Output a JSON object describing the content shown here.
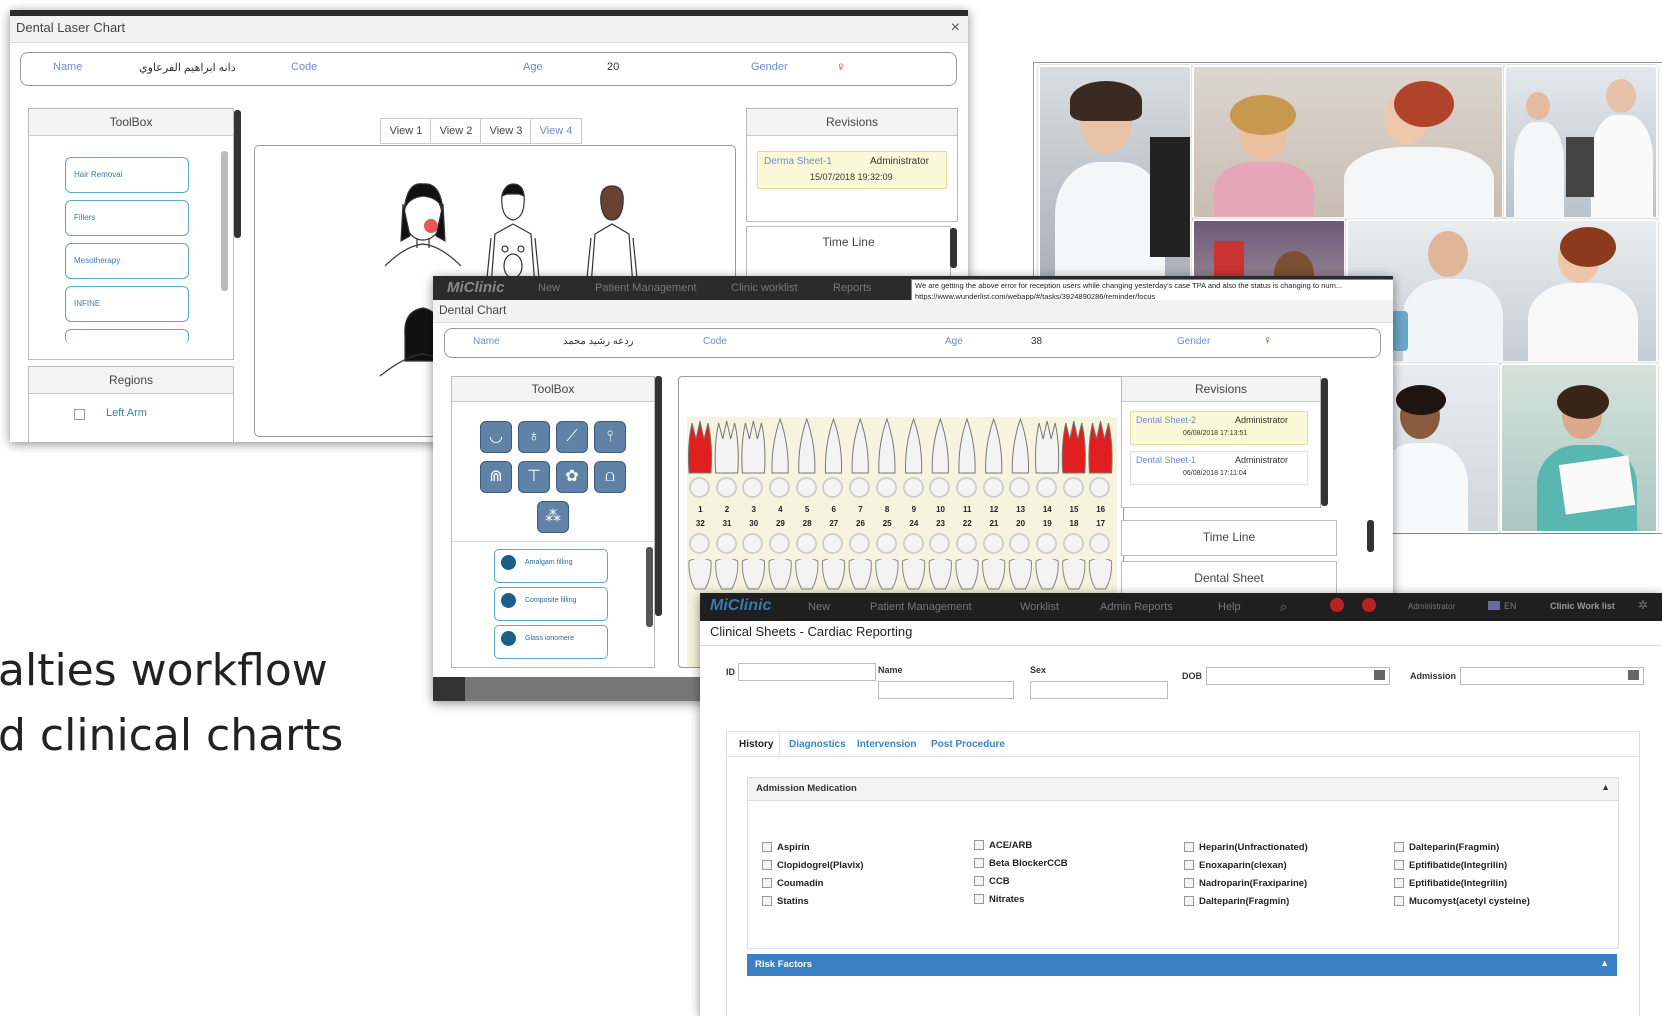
{
  "caption": {
    "line1": "alties workflow",
    "line2": "d clinical charts"
  },
  "laser_chart": {
    "title": "Dental Laser Chart",
    "close": "×",
    "patient": {
      "name_label": "Name",
      "name_value": "دانه ابراهيم الفرعاوي",
      "code_label": "Code",
      "age_label": "Age",
      "age_value": "20",
      "gender_label": "Gender",
      "gender_icon": "♀"
    },
    "toolbox": {
      "title": "ToolBox",
      "items": [
        "Hair Removal",
        "Fillers",
        "Mesotherapy",
        "INFINE"
      ]
    },
    "regions": {
      "title": "Regions",
      "items": [
        "Left Arm"
      ]
    },
    "views": [
      "View 1",
      "View 2",
      "View 3",
      "View 4"
    ],
    "revisions": {
      "title": "Revisions",
      "items": [
        {
          "name": "Derma Sheet-1",
          "user": "Administrator",
          "date": "15/07/2018 19:32:09"
        }
      ]
    },
    "timeline": {
      "title": "Time Line"
    }
  },
  "dental_chart": {
    "nav": {
      "logo": "MiClinic",
      "items": [
        "New",
        "Patient Management",
        "Clinic worklist",
        "Reports"
      ]
    },
    "tooltip": {
      "line1": "We are getting the above error for reception users while changing yesterday's case TPA and also the status is changing to num...",
      "line2": "https://www.wunderlist.com/webapp/#/tasks/3924890286/reminder/focus"
    },
    "title": "Dental Chart",
    "patient": {
      "name_label": "Name",
      "name_value": "ردعه رشيد محمد",
      "code_label": "Code",
      "age_label": "Age",
      "age_value": "38",
      "gender_label": "Gender",
      "gender_icon": "♀"
    },
    "toolbox": {
      "title": "ToolBox",
      "fillings": [
        "Amalgam filling",
        "Composite filling",
        "Glass ionomere"
      ]
    },
    "upper_numbers": [
      "1",
      "2",
      "3",
      "4",
      "5",
      "6",
      "7",
      "8",
      "9",
      "10",
      "11",
      "12",
      "13",
      "14",
      "15",
      "16"
    ],
    "lower_numbers": [
      "32",
      "31",
      "30",
      "29",
      "28",
      "27",
      "26",
      "25",
      "24",
      "23",
      "22",
      "21",
      "20",
      "19",
      "18",
      "17"
    ],
    "revisions": {
      "title": "Revisions",
      "items": [
        {
          "name": "Dental Sheet-2",
          "user": "Administrator",
          "date": "06/08/2018 17:13:51"
        },
        {
          "name": "Dental Sheet-1",
          "user": "Administrator",
          "date": "06/08/2018 17:11:04"
        }
      ]
    },
    "timeline": {
      "title": "Time Line"
    },
    "dental_sheet": {
      "title": "Dental Sheet"
    },
    "colors": {
      "decay": "#e02020",
      "tooth": "#f3f3f3"
    }
  },
  "cardiac": {
    "nav": {
      "logo": "MiClinic",
      "items": [
        "New",
        "Patient Management",
        "Worklist",
        "Admin Reports",
        "Help"
      ],
      "user": "Administrator",
      "lang": "EN",
      "worklist": "Clinic Work list"
    },
    "title": "Clinical Sheets - Cardiac Reporting",
    "fields": {
      "id": "ID",
      "name": "Name",
      "sex": "Sex",
      "dob": "DOB",
      "admission": "Admission"
    },
    "tabs": [
      "History",
      "Diagnostics",
      "Intervension",
      "Post Procedure"
    ],
    "section1": {
      "title": "Admission Medication",
      "toggle": "▲"
    },
    "medications": [
      [
        "Aspirin",
        "Clopidogrel(Plavix)",
        "Coumadin",
        "Statins"
      ],
      [
        "ACE/ARB",
        "Beta BlockerCCB",
        "CCB",
        "Nitrates"
      ],
      [
        "Heparin(Unfractionated)",
        "Enoxaparin(clexan)",
        "Nadroparin(Fraxiparine)",
        "Dalteparin(Fragmin)"
      ],
      [
        "Dalteparin(Fragmin)",
        "Eptifibatide(Integrilin)",
        "Eptifibatide(Integrilin)",
        "Mucomyst(acetyl cysteine)"
      ]
    ],
    "section2": {
      "title": "Risk Factors",
      "toggle": "▲"
    },
    "colors": {
      "accent": "#3a87c4",
      "section_bar": "#3b7fc4"
    }
  }
}
